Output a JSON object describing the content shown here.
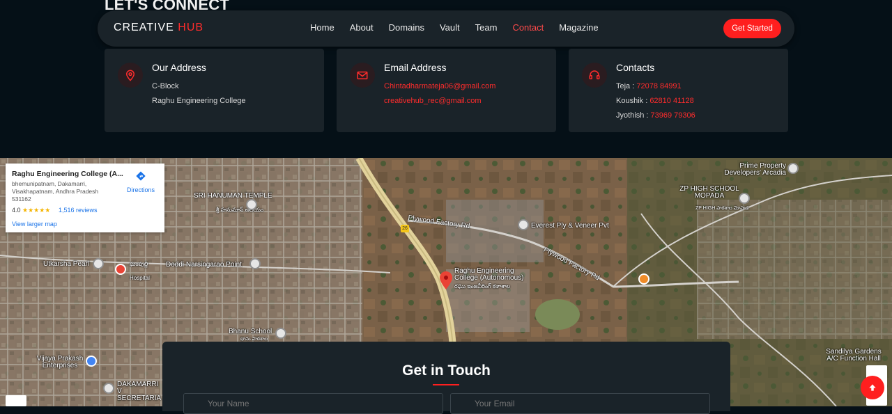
{
  "heading": "LET'S CONNECT",
  "navbar": {
    "brand_main": "CREATIVE",
    "brand_accent": "HUB",
    "links": [
      "Home",
      "About",
      "Domains",
      "Vault",
      "Team",
      "Contact",
      "Magazine"
    ],
    "active_link": "Contact",
    "cta_label": "Get Started"
  },
  "cards": {
    "address": {
      "title": "Our Address",
      "line1": "C-Block",
      "line2": "Raghu Engineering College"
    },
    "email": {
      "title": "Email Address",
      "email1": "Chintadharmateja06@gmail.com",
      "email2": "creativehub_rec@gmail.com"
    },
    "contacts": {
      "title": "Contacts",
      "people": [
        {
          "name": "Teja :",
          "phone": "72078 84991"
        },
        {
          "name": "Koushik :",
          "phone": "62810 41128"
        },
        {
          "name": "Jyothish :",
          "phone": "73969 79306"
        }
      ]
    }
  },
  "map": {
    "card": {
      "title": "Raghu Engineering College (A...",
      "address": "bhemunipatnam, Dakamarri, Visakhapatnam, Andhra Pradesh 531162",
      "rating": "4.0",
      "stars": "★★★★★",
      "reviews": "1,516 reviews",
      "view_larger": "View larger map",
      "directions": "Directions"
    },
    "labels": {
      "sri_hanuman": "SRI HANUMAN TEMPLE",
      "sri_hanuman_te": "శ్రీ హనుమాన్ ఆలయం",
      "prime_property": "Prime Property Developers' Arcadia",
      "zp_school": "ZP HIGH SCHOOL MOPADA",
      "zp_school_te": "ZP HIGH పాఠశాల మోపాడ",
      "plywood_road_1": "Plywood Factory Rd",
      "plywood_road_2": "Plywood Factory Rd",
      "everest": "Everest Ply & Veneer Pvt",
      "utkarsha": "Utkarsha Pearl",
      "hospital": "Hospital",
      "hospital_te": "ఘంపుల్లి",
      "doddi": "Doddi Narsingarao Point",
      "raghu_college": "Raghu Engineering College (Autonomous)",
      "raghu_college_te": "రఘు ఇంజనీరింగ్ కళాశాల",
      "bhanu_school": "Bhanu School",
      "bhanu_school_te": "భాను పాఠశాల",
      "vijaya_prakash": "Vijaya Prakash Enterprises",
      "dakamarri": "DAKAMARRI V SECRETARIA",
      "sandilya": "Sandilya Gardens A/C Function Hall",
      "road_number": "26"
    }
  },
  "get_in_touch": {
    "title": "Get in Touch",
    "name_placeholder": "Your Name",
    "email_placeholder": "Your Email"
  },
  "colors": {
    "accent": "#ff1f1f",
    "background": "#051017",
    "card": "#1a2329"
  }
}
